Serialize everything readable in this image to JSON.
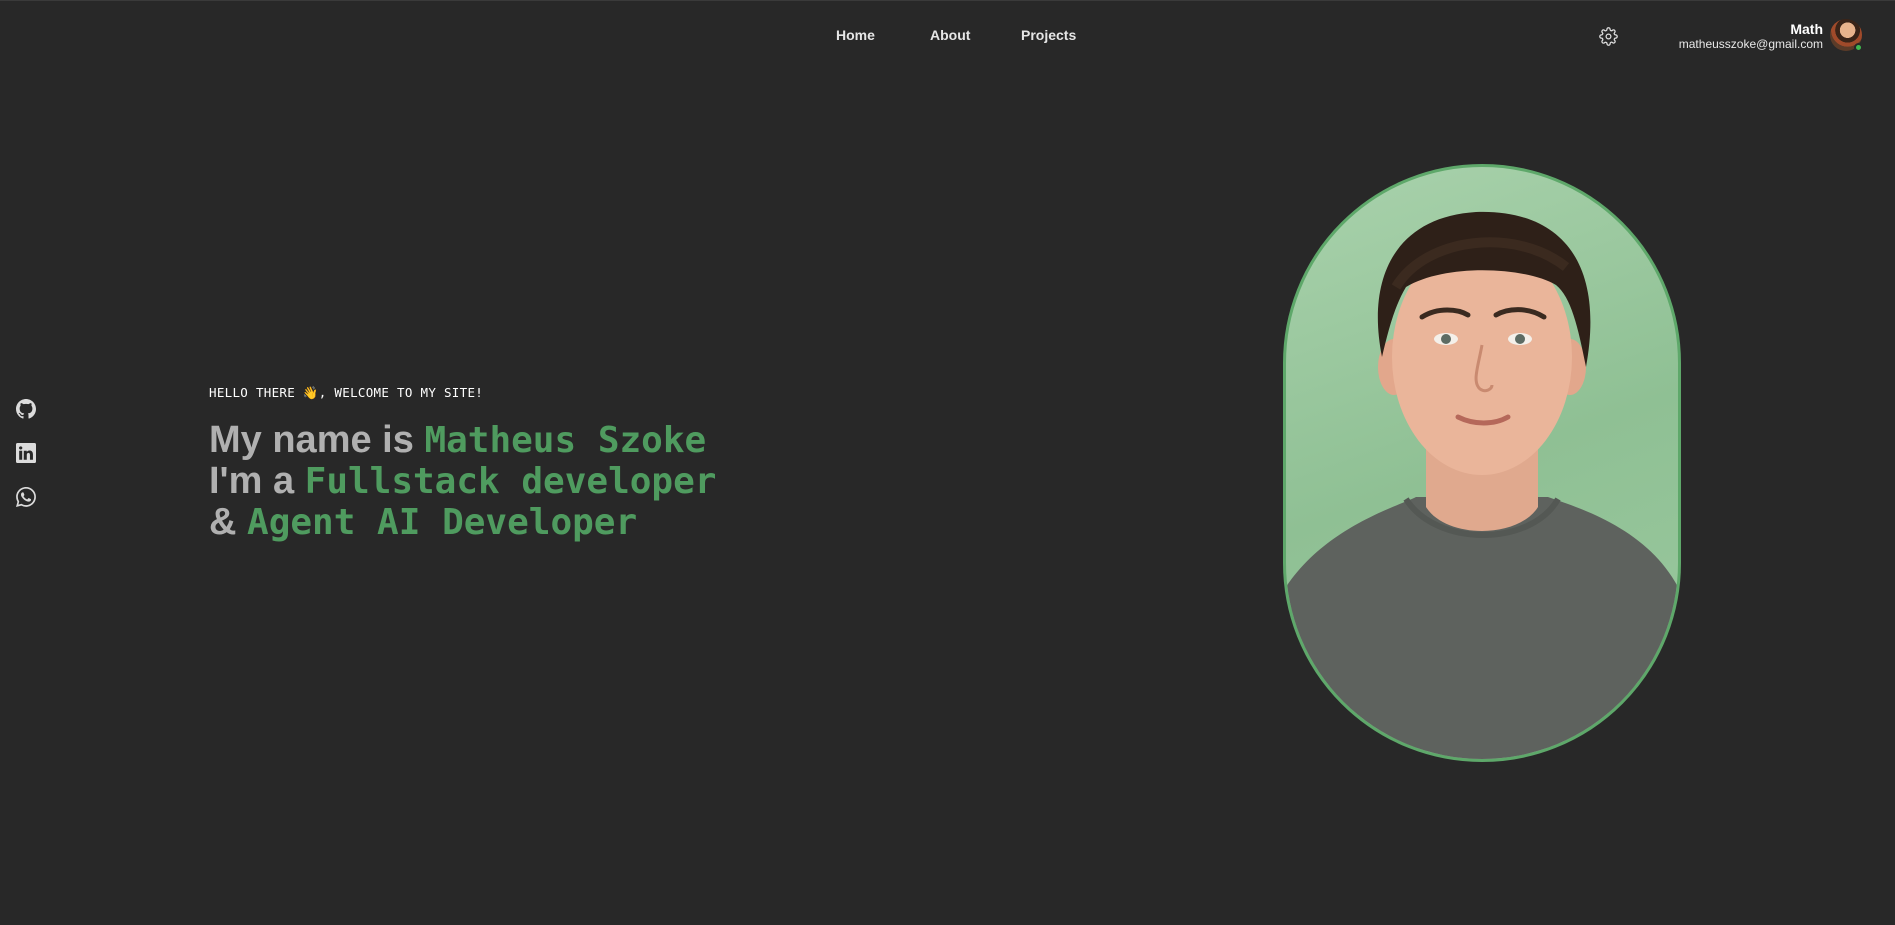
{
  "nav": {
    "items": [
      {
        "label": "Home"
      },
      {
        "label": "About"
      },
      {
        "label": "Projects"
      }
    ]
  },
  "user": {
    "name": "Math",
    "email": "matheusszoke@gmail.com",
    "status_color": "#3fb950"
  },
  "icons": {
    "settings": "gear-icon",
    "social": [
      "github-icon",
      "linkedin-icon",
      "whatsapp-icon"
    ]
  },
  "hero": {
    "greeting": "HELLO THERE 👋, WELCOME TO MY SITE!",
    "line1_prefix": "My name is",
    "line1_accent": "Matheus Szoke",
    "line2_prefix": "I'm a",
    "line2_accent": "Fullstack developer",
    "line3_prefix": "&",
    "line3_accent": "Agent AI Developer"
  },
  "colors": {
    "background": "#282828",
    "accent": "#4f9b5f",
    "text_muted": "#b0b0b0"
  }
}
